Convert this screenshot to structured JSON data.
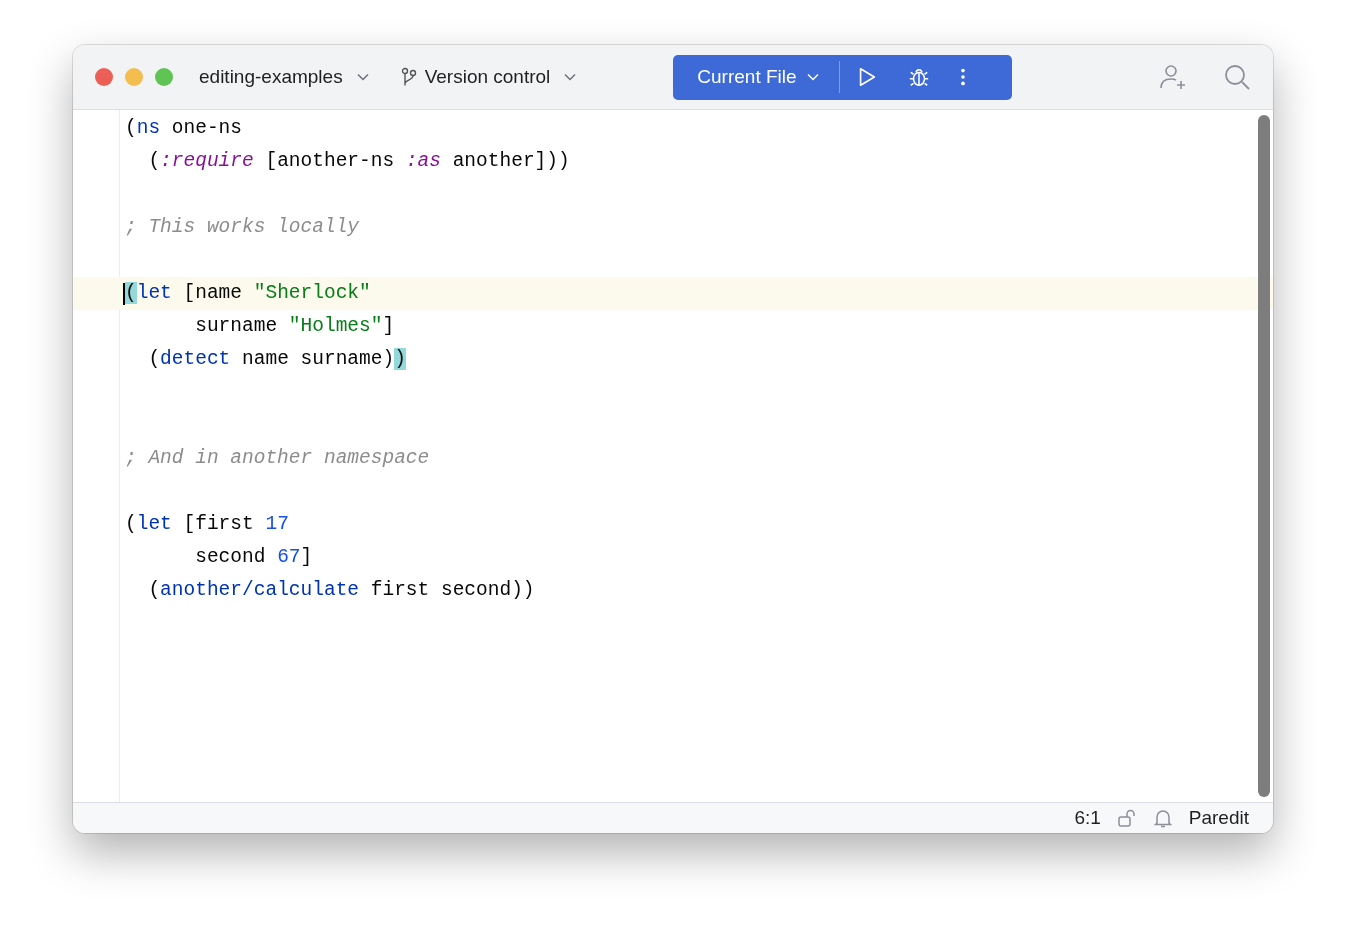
{
  "toolbar": {
    "project": "editing-examples",
    "vcs": "Version control",
    "run_config": "Current File"
  },
  "editor": {
    "lines": [
      {
        "kind": "code",
        "current": false,
        "tokens": [
          {
            "kind": "plain",
            "text": "("
          },
          {
            "kind": "keyword",
            "text": "ns"
          },
          {
            "kind": "plain",
            "text": " one-ns"
          }
        ]
      },
      {
        "kind": "code",
        "current": false,
        "tokens": [
          {
            "kind": "plain",
            "text": "  ("
          },
          {
            "kind": "symbol",
            "text": ":require"
          },
          {
            "kind": "plain",
            "text": " [another-ns "
          },
          {
            "kind": "symbol",
            "text": ":as"
          },
          {
            "kind": "plain",
            "text": " another]))"
          }
        ]
      },
      {
        "kind": "blank"
      },
      {
        "kind": "code",
        "current": false,
        "tokens": [
          {
            "kind": "comment",
            "text": "; This works locally"
          }
        ]
      },
      {
        "kind": "blank"
      },
      {
        "kind": "code",
        "current": true,
        "tokens": [
          {
            "kind": "match",
            "text": "("
          },
          {
            "kind": "keyword",
            "text": "let"
          },
          {
            "kind": "plain",
            "text": " [name "
          },
          {
            "kind": "string",
            "text": "\"Sherlock\""
          }
        ]
      },
      {
        "kind": "code",
        "current": false,
        "tokens": [
          {
            "kind": "plain",
            "text": "      surname "
          },
          {
            "kind": "string",
            "text": "\"Holmes\""
          },
          {
            "kind": "plain",
            "text": "]"
          }
        ]
      },
      {
        "kind": "code",
        "current": false,
        "tokens": [
          {
            "kind": "plain",
            "text": "  ("
          },
          {
            "kind": "keyword",
            "text": "detect"
          },
          {
            "kind": "plain",
            "text": " name surname)"
          },
          {
            "kind": "match",
            "text": ")"
          }
        ]
      },
      {
        "kind": "blank"
      },
      {
        "kind": "blank"
      },
      {
        "kind": "code",
        "current": false,
        "tokens": [
          {
            "kind": "comment",
            "text": "; And in another namespace"
          }
        ]
      },
      {
        "kind": "blank"
      },
      {
        "kind": "code",
        "current": false,
        "tokens": [
          {
            "kind": "plain",
            "text": "("
          },
          {
            "kind": "keyword",
            "text": "let"
          },
          {
            "kind": "plain",
            "text": " [first "
          },
          {
            "kind": "number",
            "text": "17"
          }
        ]
      },
      {
        "kind": "code",
        "current": false,
        "tokens": [
          {
            "kind": "plain",
            "text": "      second "
          },
          {
            "kind": "number",
            "text": "67"
          },
          {
            "kind": "plain",
            "text": "]"
          }
        ]
      },
      {
        "kind": "code",
        "current": false,
        "tokens": [
          {
            "kind": "plain",
            "text": "  ("
          },
          {
            "kind": "keyword",
            "text": "another/calculate"
          },
          {
            "kind": "plain",
            "text": " first second))"
          }
        ]
      }
    ]
  },
  "status_bar": {
    "position": "6:1",
    "mode": "Paredit"
  }
}
